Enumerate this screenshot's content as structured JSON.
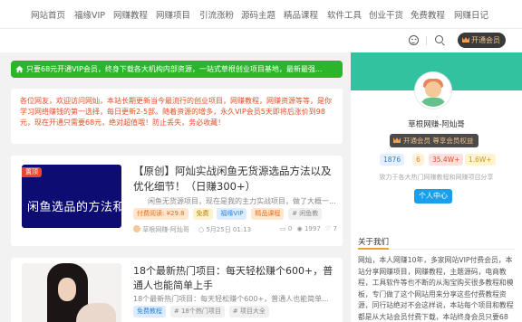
{
  "nav": {
    "items": [
      "网站首页",
      "福缘VIP",
      "网赚教程",
      "网赚项目",
      "引流涨粉",
      "源码主题",
      "精品课程",
      "软件工具",
      "创业干货",
      "免费教程",
      "网赚日记"
    ]
  },
  "header": {
    "vip_label": "开通会员"
  },
  "notice": {
    "text": "只要68元开通VIP会员，终身下载各大机构内部资源，一站式草根创业项目基地，最新最强..."
  },
  "announcement": {
    "text": "各位网友，欢迎访问网灿，本站长期更新当今最流行的创业项目，网赚教程，网赚资源等等，是你学习网络赚钱的第一选择，每日更新2-5部。随着资源的增多，永久VIP会员5天即将后涨价到98元，现在开通只需要68元，绝对超值哦！防止丢失，务必收藏！"
  },
  "posts": [
    {
      "badge": "置顶",
      "thumb_text": "闲鱼选品的方法和技巧",
      "title": "【原创】阿灿实战闲鱼无货源选品方法以及优化细节！（日赚300+）",
      "excerpt": "闲鱼无货源项目，现在是我的主力实战项目，做了大概一...",
      "chips": [
        {
          "label": "付费阅读: ¥29.8",
          "bg": "#fde7d0",
          "fg": "#e0701e"
        },
        {
          "label": "免费",
          "bg": "#fdf2d0",
          "fg": "#b38414"
        },
        {
          "label": "福缘VIP",
          "bg": "#dcecfc",
          "fg": "#2a84d8"
        },
        {
          "label": "精品课程",
          "bg": "#fde7d0",
          "fg": "#e0701e"
        },
        {
          "label": "# 闲鱼教",
          "bg": "#f0f0f0",
          "fg": "#888"
        }
      ],
      "author": "草根网赚-阿灿哥",
      "date": "5月25日 01:13",
      "comments": "0",
      "views": "1997",
      "likes": "7"
    },
    {
      "title": "18个最新热门项目：每天轻松赚个600+，普通人也能简单上手",
      "excerpt": "18个最新热门项目：每天轻松赚个600+，普通人也能简单...",
      "chips": [
        {
          "label": "免费教程",
          "bg": "#dcecfc",
          "fg": "#2a84d8"
        },
        {
          "label": "# 18个热门项目",
          "bg": "#f0f0f0",
          "fg": "#888"
        },
        {
          "label": "# 项目大全",
          "bg": "#f0f0f0",
          "fg": "#888"
        }
      ]
    }
  ],
  "sidebar": {
    "user_name": "草根网赚-阿灿哥",
    "vip_button": "开通会员 尊享会员权益",
    "stats": [
      {
        "label": "1876",
        "bg": "#e4f0fc",
        "fg": "#2a84d8"
      },
      {
        "label": "6",
        "bg": "#fff0d8",
        "fg": "#e0801e"
      },
      {
        "label": "35.4W+",
        "bg": "#fde0dc",
        "fg": "#e04a2e"
      },
      {
        "label": "1.6W+",
        "bg": "#fff3d0",
        "fg": "#d09a10"
      }
    ],
    "description": "致力于各大热门网赚教程和网赚项目分享",
    "home_button": "个人中心",
    "about_title": "关于我们",
    "about_text": "网灿，本人网赚10年，多家网站VIP付费会员，本站分享网赚项目，网赚教程，主题源码，电商教程，工具软件等也不断的从淘宝购买很多教程和模板，专门做了这个网站用来分享这些付费教程资源，同行站绝对不会这样说，本站每个项目和教程都是从大站会员付费下载，本站终身会员只要68元"
  },
  "colors": {
    "accent_green": "#33c2a0",
    "notice_green": "#2ab52a",
    "announce_red": "#e0502a",
    "link_blue": "#1a9fe8"
  }
}
